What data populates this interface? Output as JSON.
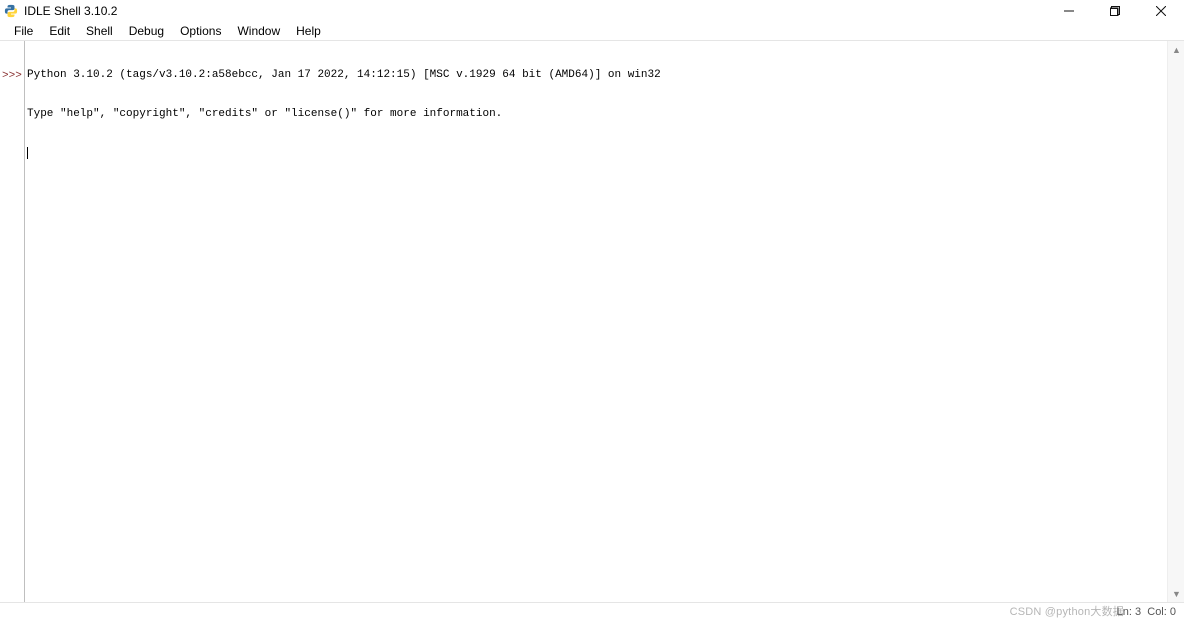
{
  "window": {
    "title": "IDLE Shell 3.10.2"
  },
  "menubar": {
    "items": [
      "File",
      "Edit",
      "Shell",
      "Debug",
      "Options",
      "Window",
      "Help"
    ]
  },
  "shell": {
    "banner_line1": "Python 3.10.2 (tags/v3.10.2:a58ebcc, Jan 17 2022, 14:12:15) [MSC v.1929 64 bit (AMD64)] on win32",
    "banner_line2": "Type \"help\", \"copyright\", \"credits\" or \"license()\" for more information.",
    "prompt": ">>>"
  },
  "status": {
    "ln_label": "Ln:",
    "ln_value": "3",
    "col_label": "Col:",
    "col_value": "0"
  },
  "watermark": "CSDN @python大数据"
}
